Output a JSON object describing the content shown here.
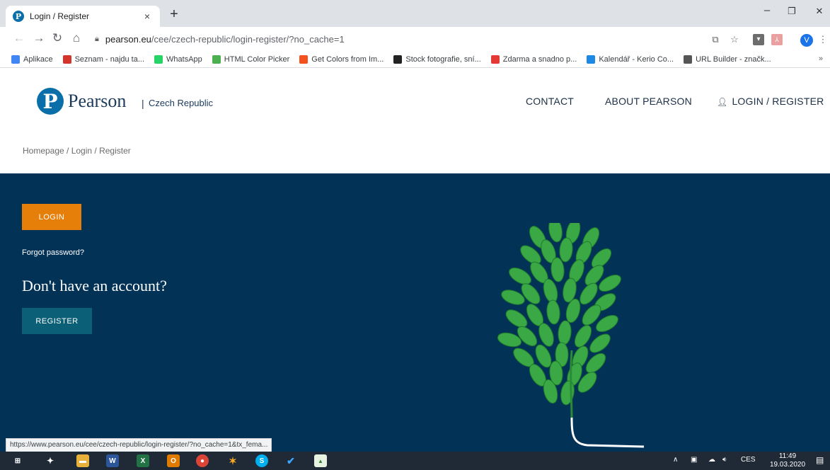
{
  "browser": {
    "tab_title": "Login / Register",
    "tab_close": "×",
    "new_tab": "+",
    "minimize": "–",
    "restore": "❐",
    "close": "✕",
    "url_host": "pearson.eu",
    "url_path": "/cee/czech-republic/login-register/?no_cache=1",
    "status_url": "https://www.pearson.eu/cee/czech-republic/login-register/?no_cache=1&tx_fema...",
    "avatar_letter": "V",
    "bookmarks": [
      {
        "label": "Aplikace",
        "color": "#4285f4"
      },
      {
        "label": "Seznam - najdu ta...",
        "color": "#d3352c"
      },
      {
        "label": "WhatsApp",
        "color": "#25d366"
      },
      {
        "label": "HTML Color Picker",
        "color": "#4caf50"
      },
      {
        "label": "Get Colors from Im...",
        "color": "#f4511e"
      },
      {
        "label": "Stock fotografie, sní...",
        "color": "#222222"
      },
      {
        "label": "Zdarma a snadno p...",
        "color": "#e53935"
      },
      {
        "label": "Kalendář - Kerio Co...",
        "color": "#1e88e5"
      },
      {
        "label": "URL Builder - značk...",
        "color": "#555555"
      }
    ],
    "bookmarks_more": "»"
  },
  "site": {
    "brand": "Pearson",
    "country_sep": "|",
    "country": "Czech Republic",
    "nav": {
      "contact": "CONTACT",
      "about": "ABOUT PEARSON",
      "login": "LOGIN / REGISTER"
    },
    "breadcrumb": "Homepage / Login / Register"
  },
  "hero": {
    "login_button": "LOGIN",
    "forgot_password": "Forgot password?",
    "no_account_heading": "Don't have an account?",
    "register_button": "REGISTER"
  },
  "taskbar": {
    "lang": "CES",
    "time": "11:49",
    "date": "19.03.2020"
  },
  "colors": {
    "hero_bg": "#033257",
    "login_button": "#e67e0a",
    "register_button": "#0b5f76",
    "brand_blue": "#0a6fa8",
    "leaf_green": "#3aa845"
  }
}
